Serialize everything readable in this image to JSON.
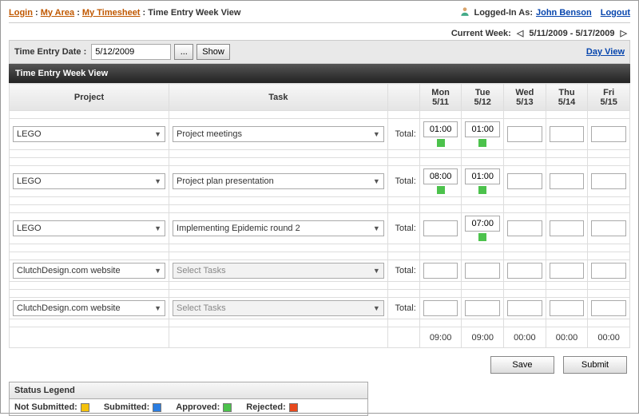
{
  "breadcrumb": {
    "login": "Login",
    "my_area": "My Area",
    "my_timesheet": "My Timesheet",
    "current": "Time Entry Week View"
  },
  "user": {
    "logged_in_as_label": "Logged-In As:",
    "name": "John Benson",
    "logout": "Logout"
  },
  "week": {
    "label": "Current Week:",
    "range": "5/11/2009 - 5/17/2009"
  },
  "datebar": {
    "label": "Time Entry Date :",
    "value": "5/12/2009",
    "show": "Show",
    "dayview": "Day View"
  },
  "title": "Time Entry Week View",
  "headers": {
    "project": "Project",
    "task": "Task",
    "days": [
      {
        "dow": "Mon",
        "date": "5/11"
      },
      {
        "dow": "Tue",
        "date": "5/12"
      },
      {
        "dow": "Wed",
        "date": "5/13"
      },
      {
        "dow": "Thu",
        "date": "5/14"
      },
      {
        "dow": "Fri",
        "date": "5/15"
      }
    ]
  },
  "rows": [
    {
      "project": "LEGO",
      "task": "Project meetings",
      "task_disabled": false,
      "total_label": "Total:",
      "cells": [
        {
          "v": "01:00",
          "s": "green"
        },
        {
          "v": "01:00",
          "s": "green"
        },
        {
          "v": "",
          "s": ""
        },
        {
          "v": "",
          "s": ""
        },
        {
          "v": "",
          "s": ""
        }
      ]
    },
    {
      "project": "LEGO",
      "task": "Project plan presentation",
      "task_disabled": false,
      "total_label": "Total:",
      "cells": [
        {
          "v": "08:00",
          "s": "green"
        },
        {
          "v": "01:00",
          "s": "green"
        },
        {
          "v": "",
          "s": ""
        },
        {
          "v": "",
          "s": ""
        },
        {
          "v": "",
          "s": ""
        }
      ]
    },
    {
      "project": "LEGO",
      "task": "Implementing Epidemic round 2",
      "task_disabled": false,
      "total_label": "Total:",
      "cells": [
        {
          "v": "",
          "s": ""
        },
        {
          "v": "07:00",
          "s": "green"
        },
        {
          "v": "",
          "s": ""
        },
        {
          "v": "",
          "s": ""
        },
        {
          "v": "",
          "s": ""
        }
      ]
    },
    {
      "project": "ClutchDesign.com website",
      "task": "Select Tasks",
      "task_disabled": true,
      "total_label": "Total:",
      "cells": [
        {
          "v": "",
          "s": ""
        },
        {
          "v": "",
          "s": ""
        },
        {
          "v": "",
          "s": ""
        },
        {
          "v": "",
          "s": ""
        },
        {
          "v": "",
          "s": ""
        }
      ]
    },
    {
      "project": "ClutchDesign.com website",
      "task": "Select Tasks",
      "task_disabled": true,
      "total_label": "Total:",
      "cells": [
        {
          "v": "",
          "s": ""
        },
        {
          "v": "",
          "s": ""
        },
        {
          "v": "",
          "s": ""
        },
        {
          "v": "",
          "s": ""
        },
        {
          "v": "",
          "s": ""
        }
      ]
    }
  ],
  "sums": [
    "09:00",
    "09:00",
    "00:00",
    "00:00",
    "00:00"
  ],
  "actions": {
    "save": "Save",
    "submit": "Submit"
  },
  "legend": {
    "title": "Status Legend",
    "not_submitted": "Not Submitted:",
    "submitted": "Submitted:",
    "approved": "Approved:",
    "rejected": "Rejected:"
  }
}
